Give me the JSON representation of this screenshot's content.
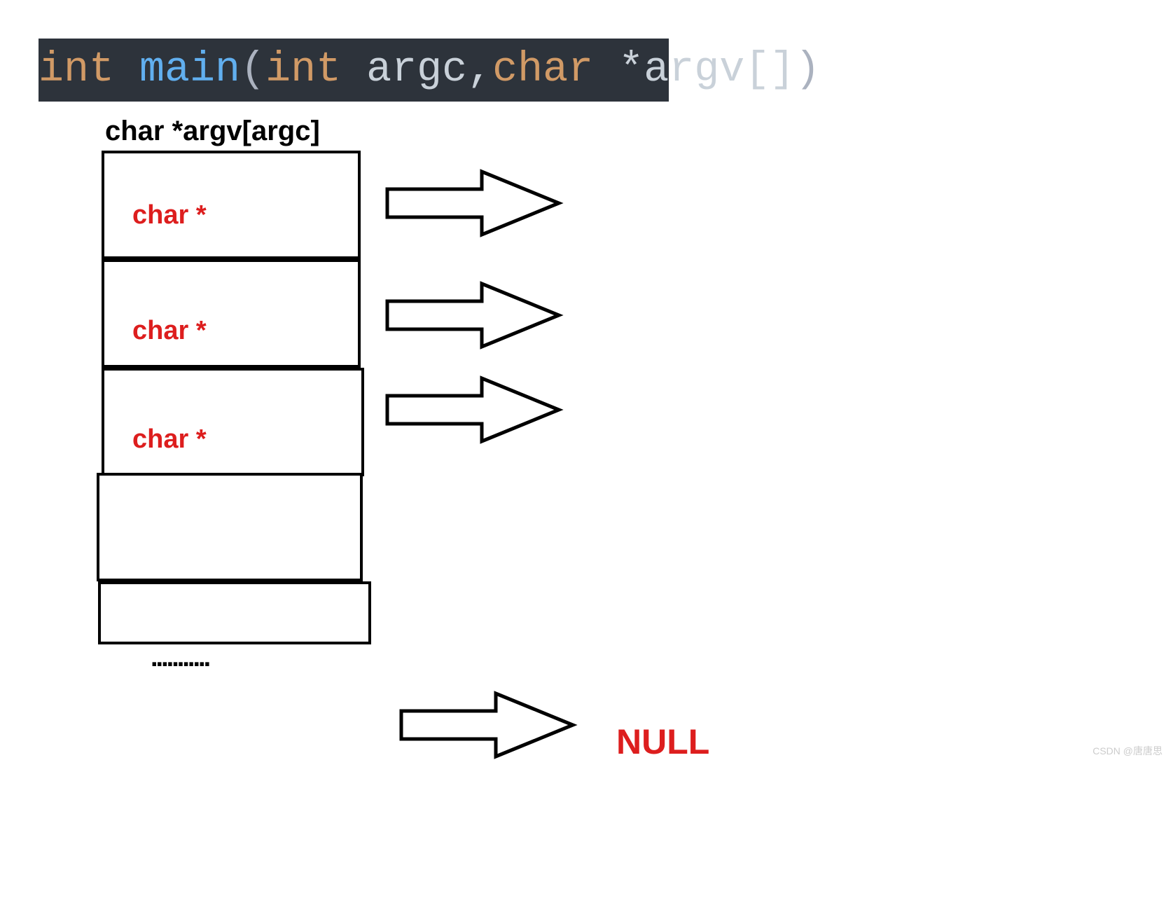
{
  "code": {
    "return_type": "int ",
    "func_name": "main",
    "open_paren": "(",
    "param1_type": "int ",
    "param1_name": "argc",
    "comma": ",",
    "param2_type": "char ",
    "param2_star": "*",
    "param2_name": "argv",
    "param2_brackets": "[]",
    "close_paren": ")"
  },
  "array_label": "char *argv[argc]",
  "cells": {
    "c0": "char *",
    "c1": "char *",
    "c2": "char *",
    "c3": "",
    "c4": ""
  },
  "dots": "...........",
  "null_label": "NULL",
  "watermark": "CSDN @唐唐思"
}
